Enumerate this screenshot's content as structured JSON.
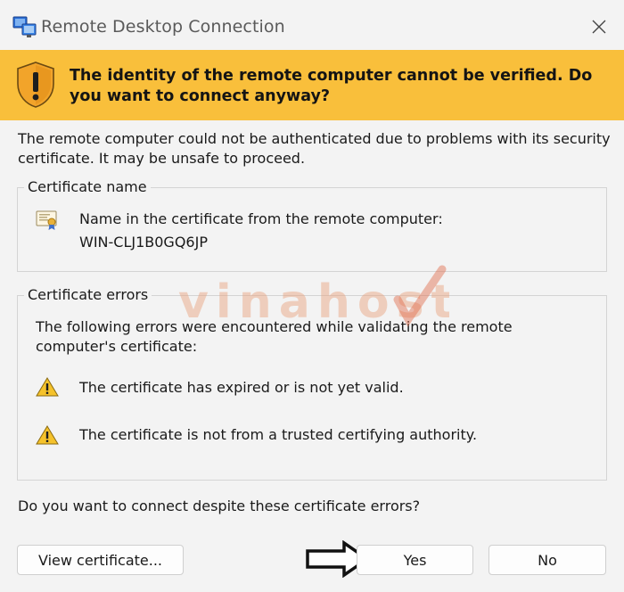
{
  "window": {
    "title": "Remote Desktop Connection",
    "close_glyph": "✕"
  },
  "banner": {
    "message": "The identity of the remote computer cannot be verified. Do you want to connect anyway?",
    "icon": "shield-warning-icon",
    "color": "#f9bf3b"
  },
  "intro": "The remote computer could not be authenticated due to problems with its security certificate. It may be unsafe to proceed.",
  "certificate_name": {
    "legend": "Certificate name",
    "label": "Name in the certificate from the remote computer:",
    "value": "WIN-CLJ1B0GQ6JP"
  },
  "certificate_errors": {
    "legend": "Certificate errors",
    "intro": "The following errors were encountered while validating the remote computer's certificate:",
    "errors": [
      "The certificate has expired or is not yet valid.",
      "The certificate is not from a trusted certifying authority."
    ]
  },
  "question": "Do you want to connect despite these certificate errors?",
  "buttons": {
    "view_certificate": "View certificate...",
    "yes": "Yes",
    "no": "No"
  },
  "watermark": {
    "text": "vinahost",
    "color": "#e8a07a"
  }
}
